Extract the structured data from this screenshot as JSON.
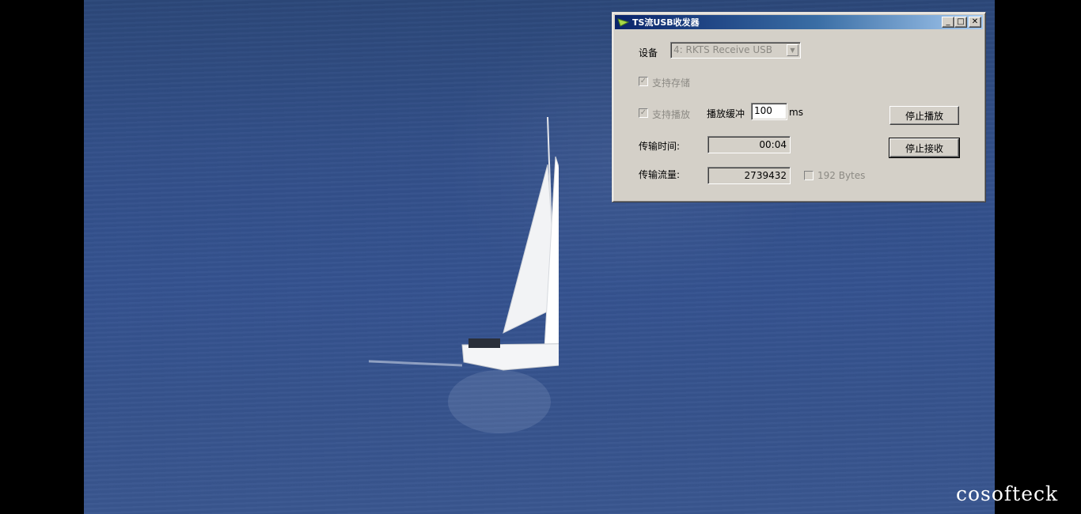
{
  "window": {
    "title": "TS流USB收发器",
    "controls": {
      "minimize": "_",
      "maximize": "□",
      "close": "✕"
    }
  },
  "device": {
    "label": "设备",
    "selected": "4: RKTS Receive USB",
    "arrow": "▼"
  },
  "options": {
    "support_storage": {
      "label": "支持存储",
      "checked": true,
      "enabled": false
    },
    "support_play": {
      "label": "支持播放",
      "checked": true,
      "enabled": false
    },
    "play_buffer": {
      "label": "播放缓冲",
      "value": "100",
      "unit": "ms"
    }
  },
  "stats": {
    "transfer_time": {
      "label": "传输时间:",
      "value": "00:04"
    },
    "transfer_flow": {
      "label": "传输流量:",
      "value": "2739432"
    },
    "bytes_192": {
      "label": "192 Bytes",
      "checked": false
    }
  },
  "buttons": {
    "stop_play": "停止播放",
    "stop_receive": "停止接收"
  },
  "watermark": "cosofteck",
  "colors": {
    "dialog_face": "#d4d0c8",
    "titlebar_start": "#0a246a",
    "titlebar_end": "#a6caf0",
    "sea": "#33508a"
  },
  "icons": {
    "app": "satellite-dish-icon"
  }
}
